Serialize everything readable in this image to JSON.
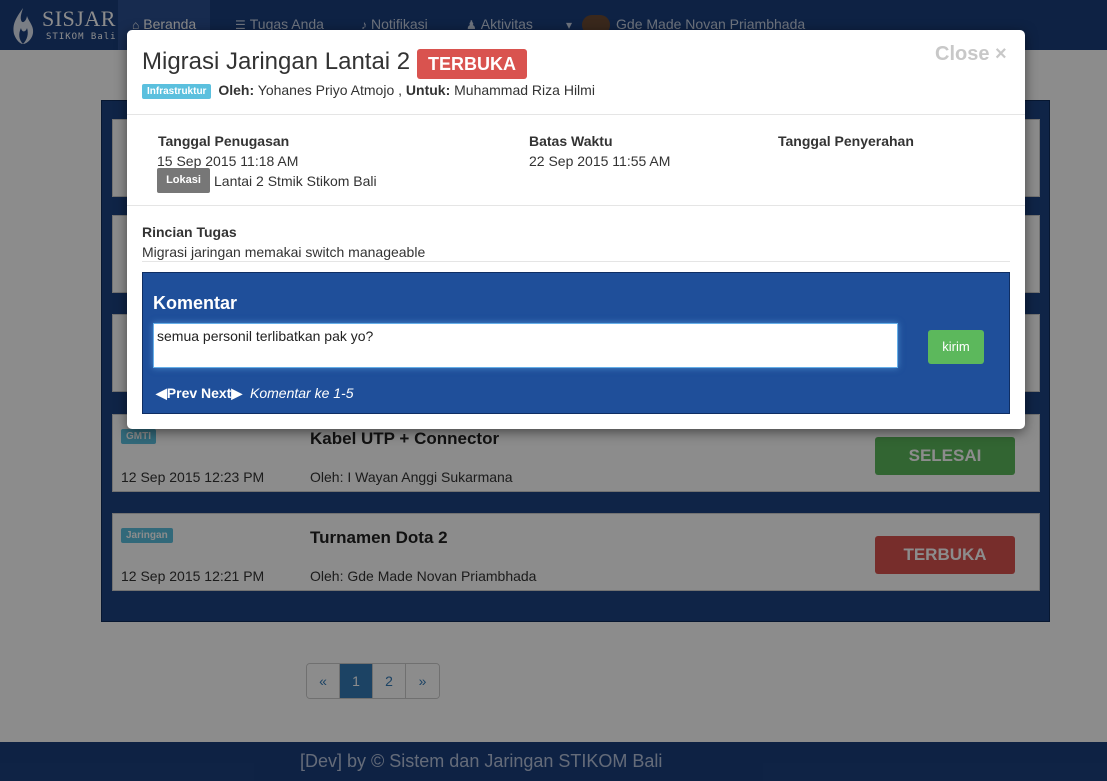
{
  "app": {
    "brand_name": "SISJAR",
    "brand_sub": "STIKOM Bali"
  },
  "nav": {
    "items": [
      {
        "label": "Beranda",
        "icon": "home-icon"
      },
      {
        "label": "Tugas Anda",
        "icon": "list-icon"
      },
      {
        "label": "Notifikasi",
        "icon": "bell-icon"
      },
      {
        "label": "Aktivitas",
        "icon": "user-icon"
      }
    ],
    "user_name": "Gde Made Novan Priambhada"
  },
  "tasks": [
    {
      "tag": "GMTI",
      "date": "12 Sep 2015 12:23 PM",
      "title": "Kabel UTP + Connector",
      "by": "Oleh: I Wayan Anggi Sukarmana",
      "status": "SELESAI",
      "status_color": "#5cb85c"
    },
    {
      "tag": "Jaringan",
      "date": "12 Sep 2015 12:21 PM",
      "title": "Turnamen Dota 2",
      "by": "Oleh: Gde Made Novan Priambhada",
      "status": "TERBUKA",
      "status_color": "#d9534f"
    }
  ],
  "pagination": {
    "prev": "«",
    "pages": [
      "1",
      "2"
    ],
    "current": "1",
    "next": "»"
  },
  "footer": {
    "text": "[Dev] by © Sistem dan Jaringan STIKOM Bali"
  },
  "modal": {
    "title": "Migrasi Jaringan Lantai 2",
    "status": "TERBUKA",
    "close_label": "Close ×",
    "category": "Infrastruktur",
    "oleh_label": "Oleh:",
    "oleh": "Yohanes Priyo Atmojo",
    "separator": ",",
    "untuk_label": "Untuk:",
    "untuk": "Muhammad Riza Hilmi",
    "tanggal_penugasan_label": "Tanggal Penugasan",
    "tanggal_penugasan": "15 Sep 2015 11:18 AM",
    "lokasi_label": "Lokasi",
    "lokasi": "Lantai 2 Stmik Stikom Bali",
    "batas_waktu_label": "Batas Waktu",
    "batas_waktu": "22 Sep 2015 11:55 AM",
    "tanggal_penyerahan_label": "Tanggal Penyerahan",
    "rincian_label": "Rincian Tugas",
    "rincian": "Migrasi jaringan memakai switch manageable",
    "komentar": {
      "title": "Komentar",
      "input_value": "semua personil terlibatkan pak yo?",
      "send_label": "kirim",
      "prev_label": "Prev",
      "next_label": "Next",
      "info": "Komentar ke 1-5"
    }
  },
  "colors": {
    "navbar": "#1b3f7d",
    "panel": "#1c4382",
    "danger": "#d9534f",
    "success": "#5cb85c",
    "info": "#5bc0de"
  }
}
